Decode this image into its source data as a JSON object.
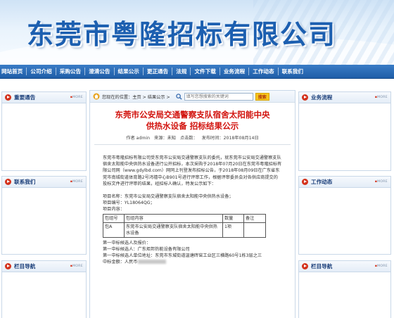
{
  "site": {
    "title": "东莞市粤隆招标有限公司"
  },
  "nav": {
    "items": [
      "网站首页",
      "公司介绍",
      "采购公告",
      "澄清公告",
      "结果公示",
      "更正通告",
      "法规",
      "文件下载",
      "业务流程",
      "工作动态",
      "联系我们"
    ]
  },
  "left_panels": [
    {
      "title": "重要通告",
      "more": "MORE"
    },
    {
      "title": "联系我们",
      "more": "MORE"
    },
    {
      "title": "栏目导航",
      "more": "MORE"
    }
  ],
  "right_panels": [
    {
      "title": "业务流程",
      "more": "MORE"
    },
    {
      "title": "工作动态",
      "more": "MORE"
    },
    {
      "title": "栏目导航",
      "more": "MORE"
    }
  ],
  "breadcrumb": {
    "text": "您现在的位置：主页 > 结果公示 >"
  },
  "search": {
    "placeholder": "填写您想搜索的关键词",
    "button_label": "搜索"
  },
  "article": {
    "title_line1": "东莞市公安局交通警察支队宿舍太阳能中央",
    "title_line2": "供热水设备 招标结果公示",
    "author": "作者 admin",
    "source": "来源：未知",
    "clicks": "点击数：",
    "date": "发布时间：2018年08月14日",
    "intro": "东莞市粤隆招标有限公司受东莞市公安局交通警察支队的委托，就东莞市公安局交通警察支队宿舍太阳能中央供热水设备进行公开招标，本次采购于2018年07月20日在东莞市粤隆招标有限公司网（www.gdylbd.com）网同上刊登发布招标公告，于2018年08月09日在广东省东莞市南城街道体育路2号鸿禧中心B901号进行评审工作，根据评审委员会对各供应商提交的投标文件进行评审的结果，经招标人确认，特发公示如下：",
    "project_name": "项目名称：东莞市公安局交通警察支队宿舍太阳能中央供热水设备；",
    "project_no": "项目编号：YL18064QG；",
    "project_content": "项目内容：",
    "table": {
      "headers": [
        "包组号",
        "包组内容",
        "数量",
        "备注"
      ],
      "rows": [
        [
          "包A",
          "东莞市公安局交通警察支队宿舍太阳能中央供热水设备",
          "1项",
          ""
        ]
      ]
    },
    "winner_heading": "第一中标候选人及报价：",
    "winner_name": "第一中标候选人：广东炬邦热能设备有限公司",
    "winner_address": "第一中标候选人单位地址：东莞市东城街道温塘砖窑工业区三横路60号1栋3层之三",
    "winner_amount": "中标金额：人民币"
  }
}
